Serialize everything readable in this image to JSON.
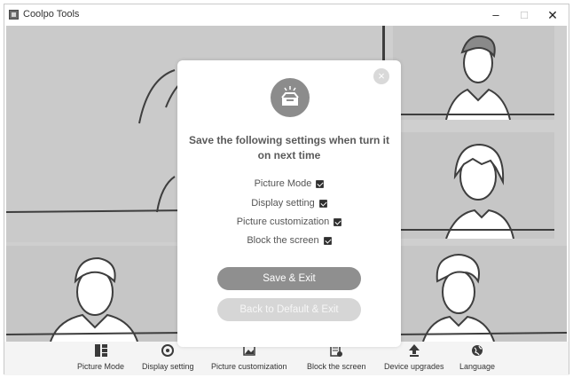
{
  "window": {
    "title": "Coolpo Tools",
    "controls": {
      "minimize": "–",
      "maximize": "□",
      "close": "✕"
    }
  },
  "modal": {
    "close_icon": "×",
    "heading": "Save the following settings when turn it on next time",
    "options": [
      {
        "label": "Picture Mode",
        "checked": true
      },
      {
        "label": "Display setting",
        "checked": true
      },
      {
        "label": "Picture customization",
        "checked": true
      },
      {
        "label": "Block the screen",
        "checked": true
      }
    ],
    "save_button": "Save & Exit",
    "default_button": "Back to Default & Exit"
  },
  "toolbar": {
    "items": [
      {
        "label": "Picture Mode",
        "icon": "layout-icon"
      },
      {
        "label": "Display setting",
        "icon": "display-setting-icon"
      },
      {
        "label": "Picture customization",
        "icon": "picture-customization-icon"
      },
      {
        "label": "Block the screen",
        "icon": "block-screen-icon"
      },
      {
        "label": "Device upgrades",
        "icon": "upgrade-arrow-icon"
      },
      {
        "label": "Language",
        "icon": "globe-icon"
      }
    ]
  }
}
